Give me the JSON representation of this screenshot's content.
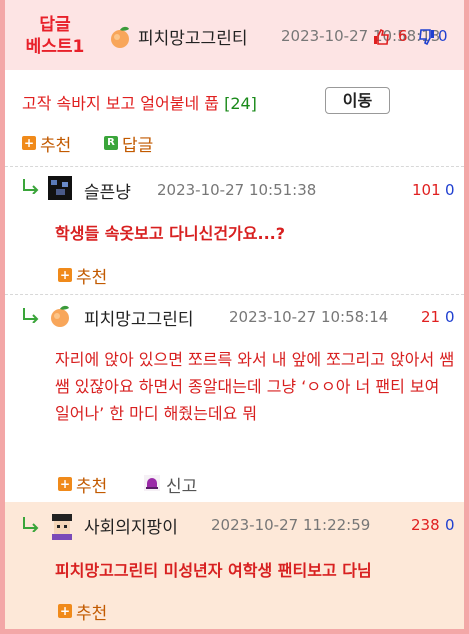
{
  "best": {
    "badge_line1": "답글",
    "badge_line2": "베스트1",
    "nickname": "피치망고그린티",
    "date": "2023-10-27 10:58:13",
    "up_count": "6",
    "down_count": "0"
  },
  "post": {
    "title": "고작 속바지 보고 얼어붙네 풉",
    "comment_count": "[24]",
    "move_label": "이동",
    "recommend_label": "추천",
    "reply_label": "답글"
  },
  "replies": [
    {
      "nickname": "슬픈냥",
      "date": "2023-10-27 10:51:38",
      "up": "101",
      "down": "0",
      "text": "학생들 속옷보고 다니신건가요...?",
      "recommend_label": "추천"
    },
    {
      "nickname": "피치망고그린티",
      "date": "2023-10-27 10:58:14",
      "up": "21",
      "down": "0",
      "text": "자리에 앉아 있으면 쪼르륵 와서 내 앞에 쪼그리고 앉아서 쌤쌤 있잖아요 하면서 종알대는데 그냥 ‘ㅇㅇ아 너 팬티 보여 일어나’ 한 마디 해줬는데요 뭐",
      "recommend_label": "추천",
      "report_label": "신고"
    },
    {
      "nickname": "사회의지팡이",
      "date": "2023-10-27 11:22:59",
      "up": "238",
      "down": "0",
      "text": "피치망고그린티 미성년자 여학생 팬티보고 다님",
      "recommend_label": "추천"
    }
  ],
  "colors": {
    "best_bg": "#fde4e4",
    "frame": "#f3a7a7",
    "highlight_bg": "#fde8d8",
    "accent_red": "#e02020",
    "accent_blue": "#2040d0",
    "recommend": "#c25a00"
  }
}
